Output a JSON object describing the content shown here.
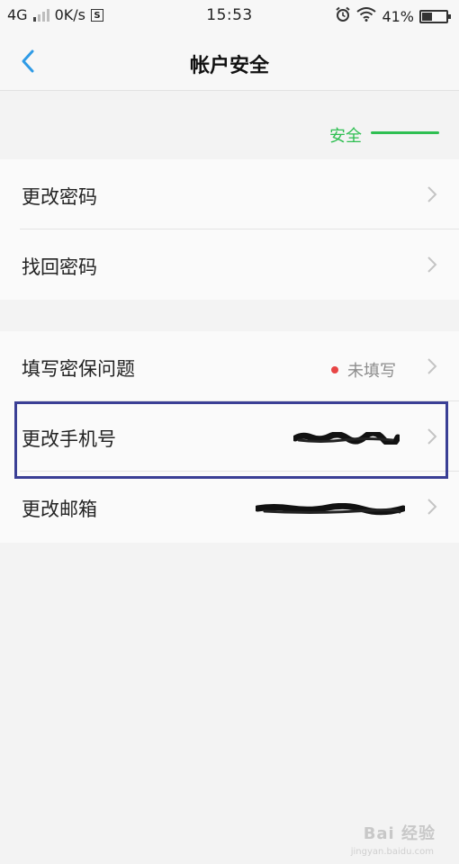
{
  "status_bar": {
    "network": "4G",
    "speed": "0K/s",
    "sim": "S",
    "time": "15:53",
    "battery": "41%",
    "battery_level": 0.41
  },
  "nav": {
    "title": "帐户安全"
  },
  "security": {
    "label": "安全",
    "color": "#2fbf52"
  },
  "groups": [
    {
      "items": [
        {
          "label": "更改密码"
        },
        {
          "label": "找回密码"
        }
      ]
    },
    {
      "items": [
        {
          "label": "填写密保问题",
          "status": "未填写"
        },
        {
          "label": "更改手机号"
        },
        {
          "label": "更改邮箱"
        }
      ]
    }
  ],
  "colors": {
    "highlight": "#3a3f95",
    "accent": "#2f9be6",
    "warning_dot": "#e84545"
  },
  "watermark": {
    "brand": "Bai 经验",
    "url": "jingyan.baidu.com"
  }
}
